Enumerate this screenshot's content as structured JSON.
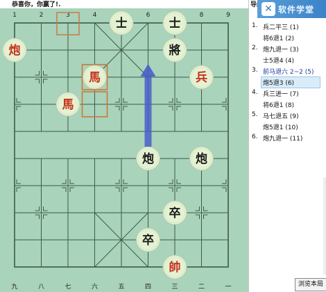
{
  "status_text": "恭喜你，你赢了!.",
  "board": {
    "top_labels": [
      "1",
      "2",
      "3",
      "4",
      "5",
      "6",
      "7",
      "8",
      "9"
    ],
    "bottom_labels": [
      "九",
      "八",
      "七",
      "六",
      "五",
      "四",
      "三",
      "二",
      "一"
    ],
    "colors": {
      "background": "#a9d3ba",
      "line": "#3c5a49",
      "red": "#c8321e",
      "black": "#1c1c1c",
      "piece_face": "#e4f2d2",
      "arrow": "#4a5ec8",
      "highlight": "#c8783c"
    },
    "pieces": [
      {
        "name": "shi-top-left",
        "char": "士",
        "side": "black",
        "col": 4,
        "row": 0
      },
      {
        "name": "shi-top-right",
        "char": "士",
        "side": "black",
        "col": 6,
        "row": 0
      },
      {
        "name": "pao-red-left",
        "char": "炮",
        "side": "red",
        "col": 0,
        "row": 1
      },
      {
        "name": "jiang",
        "char": "將",
        "side": "black",
        "col": 6,
        "row": 1
      },
      {
        "name": "ma-red-moved",
        "char": "馬",
        "side": "red",
        "col": 3,
        "row": 2
      },
      {
        "name": "bing-red",
        "char": "兵",
        "side": "red",
        "col": 7,
        "row": 2
      },
      {
        "name": "ma-red-second",
        "char": "馬",
        "side": "red",
        "col": 2,
        "row": 3
      },
      {
        "name": "pao-black-center",
        "char": "炮",
        "side": "black",
        "col": 5,
        "row": 5
      },
      {
        "name": "pao-black-right",
        "char": "炮",
        "side": "black",
        "col": 7,
        "row": 5
      },
      {
        "name": "zu-upper",
        "char": "卒",
        "side": "black",
        "col": 6,
        "row": 7
      },
      {
        "name": "zu-lower",
        "char": "卒",
        "side": "black",
        "col": 5,
        "row": 8
      },
      {
        "name": "shuai-red",
        "char": "帥",
        "side": "red",
        "col": 6,
        "row": 9
      }
    ],
    "last_move": {
      "from": [
        3,
        3
      ],
      "to": [
        3,
        2
      ]
    },
    "arrow": {
      "from": [
        5,
        5
      ],
      "to": [
        5,
        2
      ]
    }
  },
  "sidebar": {
    "header": "导航",
    "logo_text": "软件学堂",
    "moves": [
      {
        "num": "1.",
        "text": "兵二平三 (1)"
      },
      {
        "num": "",
        "text": "将6退1 (2)"
      },
      {
        "num": "2.",
        "text": "炮九退一 (3)"
      },
      {
        "num": "",
        "text": "士5退4 (4)"
      },
      {
        "num": "3.",
        "text": "前马退六 2~2 (5)",
        "highlight": true
      },
      {
        "num": "",
        "text": "炮5退3 (6)",
        "selected": true
      },
      {
        "num": "4.",
        "text": "兵三进一 (7)"
      },
      {
        "num": "",
        "text": "将6退1 (8)"
      },
      {
        "num": "5.",
        "text": "马七退五 (9)"
      },
      {
        "num": "",
        "text": "炮5退1 (10)"
      },
      {
        "num": "6.",
        "text": "炮九退一 (11)"
      }
    ],
    "browse_button": "浏览本局"
  }
}
